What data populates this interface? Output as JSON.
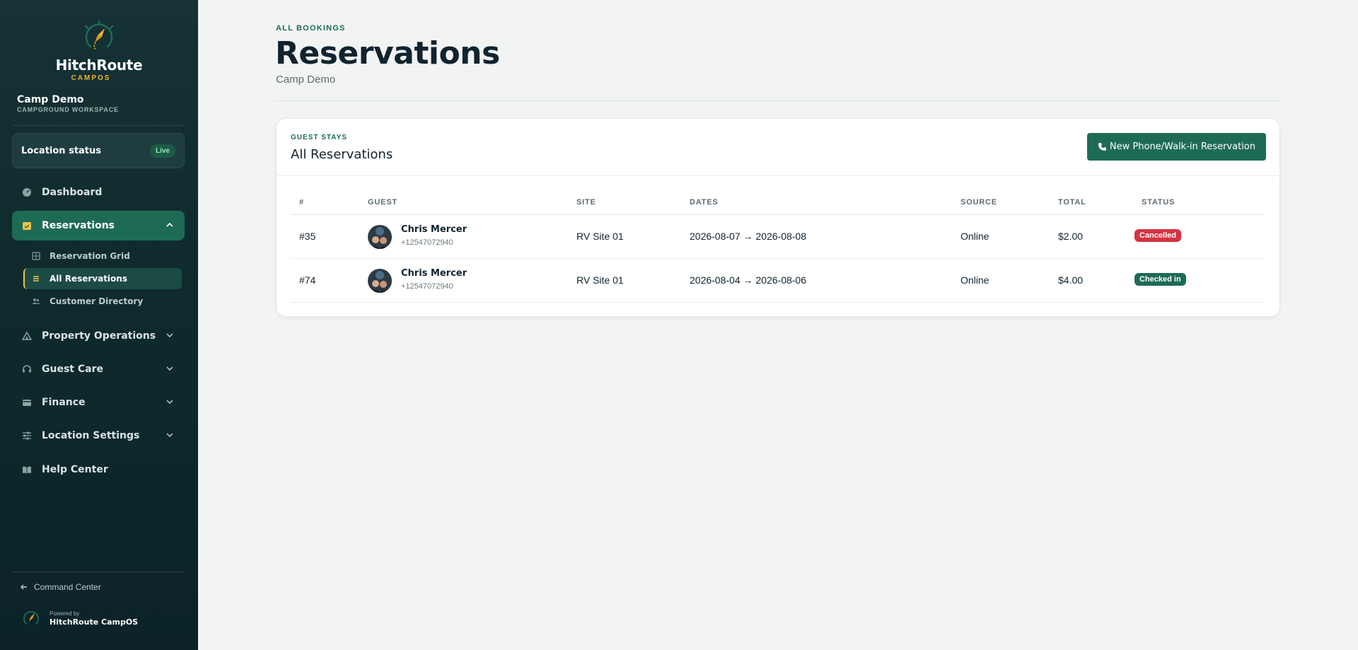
{
  "brand": {
    "name": "HitchRoute",
    "sub": "CAMPOS"
  },
  "workspace": {
    "name": "Camp Demo",
    "sub": "CAMPGROUND WORKSPACE"
  },
  "location_status": {
    "label": "Location status",
    "badge": "Live"
  },
  "nav": {
    "dashboard": "Dashboard",
    "reservations": "Reservations",
    "sub": {
      "grid": "Reservation Grid",
      "all": "All Reservations",
      "customers": "Customer Directory"
    },
    "property_operations": "Property Operations",
    "guest_care": "Guest Care",
    "finance": "Finance",
    "location_settings": "Location Settings",
    "help_center": "Help Center"
  },
  "footer": {
    "command_center": "Command Center",
    "powered_by": "Powered by",
    "product": "HitchRoute CampOS"
  },
  "page": {
    "eyebrow": "ALL BOOKINGS",
    "title": "Reservations",
    "subtitle": "Camp Demo"
  },
  "card": {
    "eyebrow": "GUEST STAYS",
    "title": "All Reservations",
    "new_button": "New Phone/Walk-in Reservation"
  },
  "table": {
    "columns": [
      "#",
      "GUEST",
      "SITE",
      "DATES",
      "SOURCE",
      "TOTAL",
      "STATUS"
    ],
    "rows": [
      {
        "id": "#35",
        "guest": "Chris Mercer",
        "phone": "+12547072940",
        "site": "RV Site 01",
        "dates": "2026-08-07 → 2026-08-08",
        "source": "Online",
        "total": "$2.00",
        "status": "Cancelled"
      },
      {
        "id": "#74",
        "guest": "Chris Mercer",
        "phone": "+12547072940",
        "site": "RV Site 01",
        "dates": "2026-08-04 → 2026-08-06",
        "source": "Online",
        "total": "$4.00",
        "status": "Checked in"
      }
    ]
  },
  "colors": {
    "accent": "#1e6b55",
    "sidebar": "#0f2a2c",
    "gold": "#f0c24a",
    "cancelled": "#d63343"
  }
}
